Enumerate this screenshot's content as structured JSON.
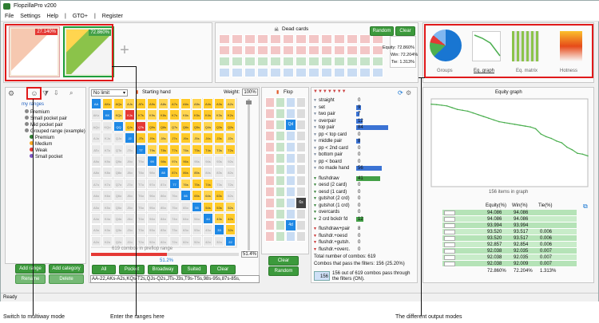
{
  "app": {
    "title": "FlopzillaPro v200"
  },
  "menu": [
    "File",
    "Settings",
    "Help",
    "|",
    "GTO+",
    "|",
    "Register"
  ],
  "top": {
    "player1_pct": "27.140%",
    "player2_pct": "72.860%"
  },
  "dead_cards": {
    "title": "Dead cards",
    "random": "Random",
    "clear": "Clear",
    "equity": "Equity: 72.860%",
    "win": "Win: 72.204%",
    "tie": "Tie: 1.313%"
  },
  "outputs": {
    "groups": "Groups",
    "eq_graph": "Eq. graph",
    "eq_matrix": "Eq. matrix",
    "hotness": "Hotness"
  },
  "ranges": {
    "root": "my ranges",
    "items": [
      "Premium",
      "Small pocket pair",
      "Mid pocket pair",
      "Grouped range (example)",
      "Premium",
      "Medium",
      "Weak",
      "Small pocket"
    ],
    "add_range": "Add range",
    "add_category": "Add category",
    "rename": "Rename",
    "delete": "Delete"
  },
  "starting_hand": {
    "limit": "No limit",
    "title": "Starting hand",
    "weight_label": "Weight:",
    "weight": "100%",
    "combos_note": "619 combos in preflop range",
    "slider_val": "51.4%",
    "slider_sub": "51.2%",
    "btn_all": "All",
    "btn_pocket": "Pocket",
    "btn_broadway": "Broadway",
    "btn_suited": "Suited",
    "btn_clear": "Clear",
    "range_text": "AA-22,AKs-A2s,KQs-T2s,QJs-Q2s,JTs-J3s,T9s-T5s,98s-95s,87s-85s,"
  },
  "grid_labels": [
    "AA",
    "AKs",
    "AQs",
    "AJs",
    "ATs",
    "A9s",
    "A8s",
    "A7s",
    "A6s",
    "A5s",
    "A4s",
    "A3s",
    "A2s"
  ],
  "flop": {
    "title": "Flop",
    "card1": "Qd",
    "card2": "6s",
    "card3": "4d",
    "clear": "Clear",
    "random": "Random"
  },
  "stats": [
    {
      "label": "straight",
      "value": "0",
      "f": 0
    },
    {
      "label": "set",
      "value": "9",
      "f": 0.15
    },
    {
      "label": "two pair",
      "value": "7",
      "f": 0.11
    },
    {
      "label": "overpair",
      "value": "12",
      "f": 0.19
    },
    {
      "label": "top pair",
      "value": "84",
      "f": 1
    },
    {
      "label": "pp < top card",
      "value": "0",
      "f": 0
    },
    {
      "label": "middle pair",
      "value": "8",
      "f": 0.13
    },
    {
      "label": "pp < 2nd card",
      "value": "0",
      "f": 0
    },
    {
      "label": "bottom pair",
      "value": "0",
      "f": 0
    },
    {
      "label": "pp < board",
      "value": "0",
      "f": 0
    },
    {
      "label": "no made hand",
      "value": "56",
      "f": 0.8
    }
  ],
  "draws": [
    {
      "label": "flushdraw",
      "value": "41",
      "f": 0.75
    },
    {
      "label": "oesd (2 card)",
      "value": "0",
      "f": 0
    },
    {
      "label": "oesd (1 card)",
      "value": "0",
      "f": 0
    },
    {
      "label": "gutshot (2 crd)",
      "value": "0",
      "f": 0
    },
    {
      "label": "gutshot (1 crd)",
      "value": "0",
      "f": 0
    },
    {
      "label": "overcards",
      "value": "0",
      "f": 0
    },
    {
      "label": "2 crd bckdr fd",
      "value": "12",
      "f": 0.22
    }
  ],
  "combo_draws": [
    {
      "label": "flushdraw+pair",
      "value": "8"
    },
    {
      "label": "flushdr.+oesd",
      "value": "0"
    },
    {
      "label": "flushdr.+gutsh.",
      "value": "0"
    },
    {
      "label": "flushdr.+overc.",
      "value": "0"
    }
  ],
  "totals": {
    "total": "Total number of combos: 619",
    "pass": "Combos that pass the filters: 156 (25.20%)",
    "filter_count": "156",
    "filter_note": "156 out of 619 combos pass through the filters (ON)."
  },
  "graph": {
    "title": "Equity graph",
    "items": "156 items in graph",
    "headers": [
      "Equity(%)",
      "Win(%)",
      "Tie(%)"
    ],
    "rows": [
      [
        "94.086",
        "94.086",
        ""
      ],
      [
        "94.086",
        "94.086",
        ""
      ],
      [
        "93.994",
        "93.994",
        ""
      ],
      [
        "93.520",
        "93.517",
        "0.006"
      ],
      [
        "93.520",
        "93.517",
        "0.006"
      ],
      [
        "92.857",
        "92.854",
        "0.006"
      ],
      [
        "92.038",
        "92.035",
        "0.007"
      ],
      [
        "92.038",
        "92.035",
        "0.007"
      ],
      [
        "92.038",
        "92.009",
        "0.007"
      ]
    ],
    "totals": [
      "72.860%",
      "72.204%",
      "1.313%"
    ]
  },
  "status": "Ready",
  "annotations": {
    "multiway": "Switch to multiway mode",
    "ranges": "Enter the ranges here",
    "outputs": "The different output modes"
  },
  "chart_data": {
    "type": "line",
    "title": "Equity graph",
    "xlabel": "156 items in graph",
    "ylabel": "",
    "ylim": [
      0,
      100
    ],
    "series": [
      {
        "values": [
          94,
          93.5,
          92.8,
          92,
          90,
          88,
          87,
          86,
          84,
          82,
          80,
          78,
          76,
          74,
          73,
          72,
          71,
          70,
          69,
          68,
          66,
          60,
          57,
          55,
          52,
          50,
          45,
          42,
          38,
          37,
          35
        ]
      }
    ]
  }
}
